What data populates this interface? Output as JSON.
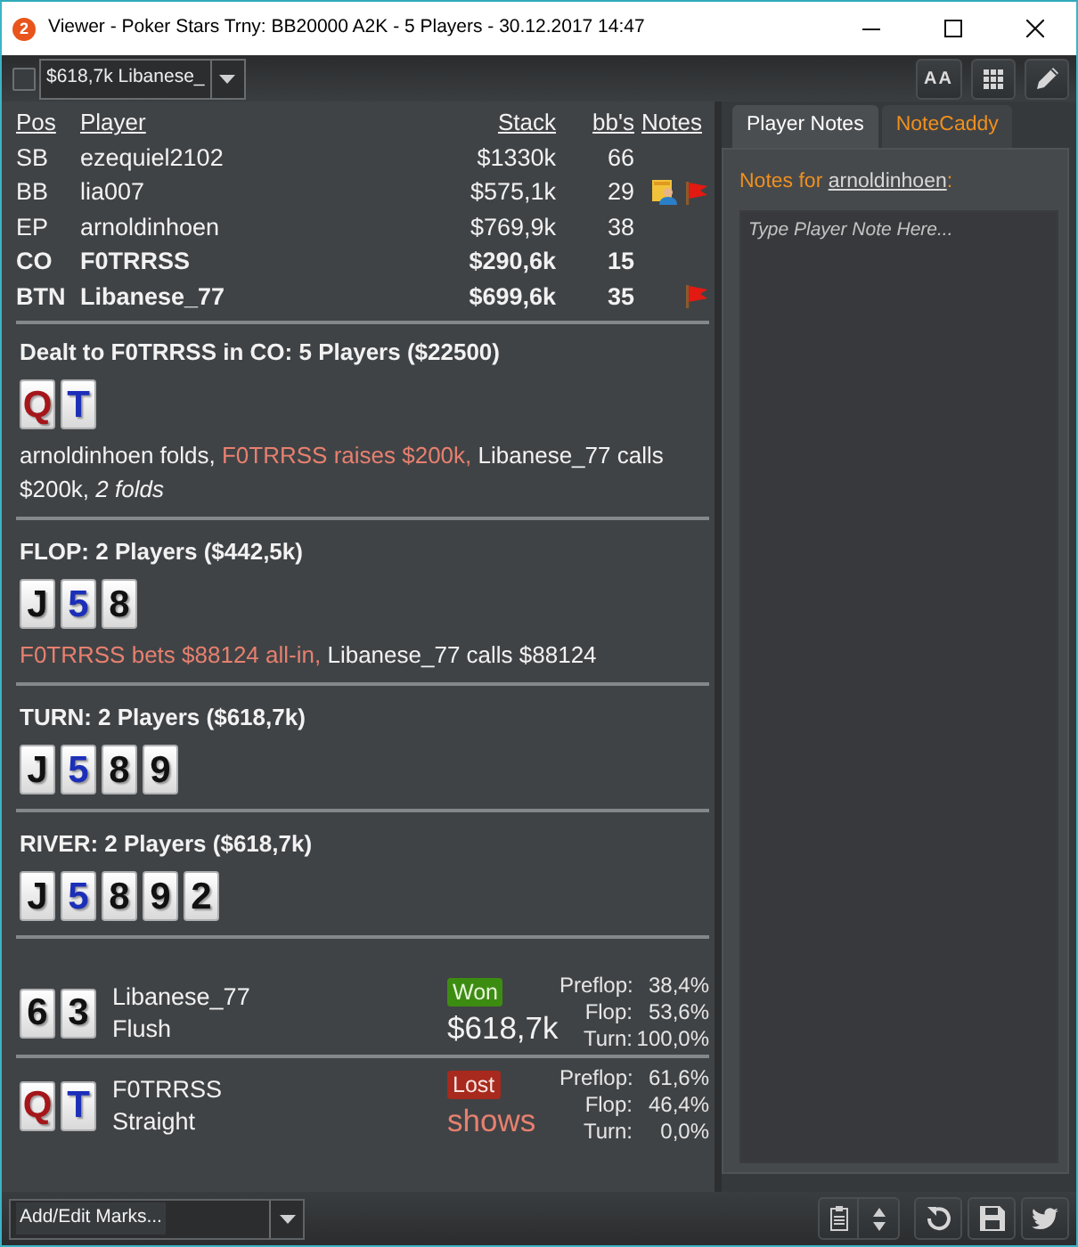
{
  "window": {
    "logo": "2",
    "title": "Viewer - Poker Stars Trny: BB20000 A2K - 5 Players - 30.12.2017 14:47"
  },
  "toolbar": {
    "select_all_checked": false,
    "hand_selector": "$618,7k Libanese_",
    "font_button": "AA"
  },
  "players_table": {
    "columns": [
      "Pos",
      "Player",
      "Stack",
      "bb's",
      "Notes"
    ],
    "rows": [
      {
        "pos": "SB",
        "player": "ezequiel2102",
        "stack": "$1330k",
        "bbs": "66",
        "bold": false,
        "note": false,
        "flag": false
      },
      {
        "pos": "BB",
        "player": "lia007",
        "stack": "$575,1k",
        "bbs": "29",
        "bold": false,
        "note": true,
        "flag": true
      },
      {
        "pos": "EP",
        "player": "arnoldinhoen",
        "stack": "$769,9k",
        "bbs": "38",
        "bold": false,
        "note": false,
        "flag": false
      },
      {
        "pos": "CO",
        "player": "F0TRRSS",
        "stack": "$290,6k",
        "bbs": "15",
        "bold": true,
        "note": false,
        "flag": false
      },
      {
        "pos": "BTN",
        "player": "Libanese_77",
        "stack": "$699,6k",
        "bbs": "35",
        "bold": true,
        "note": false,
        "flag": true
      }
    ]
  },
  "streets": [
    {
      "title": "Dealt to F0TRRSS in CO: 5 Players ($22500)",
      "cards": [
        {
          "rank": "Q",
          "color": "#a4161a"
        },
        {
          "rank": "T",
          "color": "#1c2fb8"
        }
      ],
      "actions": [
        {
          "text": "arnoldinhoen folds,",
          "highlight": false
        },
        {
          "text": "F0TRRSS raises $200k,",
          "highlight": true
        },
        {
          "text": "Libanese_77 calls $200k, *2 folds*",
          "highlight": false
        }
      ]
    },
    {
      "title": "FLOP: 2 Players ($442,5k)",
      "cards": [
        {
          "rank": "J",
          "color": "#111111"
        },
        {
          "rank": "5",
          "color": "#1c2fb8"
        },
        {
          "rank": "8",
          "color": "#111111"
        }
      ],
      "actions": [
        {
          "text": "F0TRRSS bets $88124 all-in,",
          "highlight": true
        },
        {
          "text": "Libanese_77 calls $88124",
          "highlight": false
        }
      ]
    },
    {
      "title": "TURN: 2 Players ($618,7k)",
      "cards": [
        {
          "rank": "J",
          "color": "#111111"
        },
        {
          "rank": "5",
          "color": "#1c2fb8"
        },
        {
          "rank": "8",
          "color": "#111111"
        },
        {
          "rank": "9",
          "color": "#111111"
        }
      ]
    },
    {
      "title": "RIVER: 2 Players ($618,7k)",
      "cards": [
        {
          "rank": "J",
          "color": "#111111"
        },
        {
          "rank": "5",
          "color": "#1c2fb8"
        },
        {
          "rank": "8",
          "color": "#111111"
        },
        {
          "rank": "9",
          "color": "#111111"
        },
        {
          "rank": "2",
          "color": "#111111"
        }
      ]
    }
  ],
  "showdown": [
    {
      "cards": [
        {
          "rank": "6",
          "color": "#111111"
        },
        {
          "rank": "3",
          "color": "#111111"
        }
      ],
      "player": "Libanese_77",
      "hand": "Flush",
      "result": {
        "label": "Won",
        "kind": "won"
      },
      "amount": "$618,7k",
      "equity": [
        {
          "street": "Preflop:",
          "value": "38,4%"
        },
        {
          "street": "Flop:",
          "value": "53,6%"
        },
        {
          "street": "Turn:",
          "value": "100,0%"
        }
      ]
    },
    {
      "cards": [
        {
          "rank": "Q",
          "color": "#a4161a"
        },
        {
          "rank": "T",
          "color": "#1c2fb8"
        }
      ],
      "player": "F0TRRSS",
      "hand": "Straight",
      "result": {
        "label": "Lost",
        "kind": "lost"
      },
      "amount": "shows",
      "equity": [
        {
          "street": "Preflop:",
          "value": "61,6%"
        },
        {
          "street": "Flop:",
          "value": "46,4%"
        },
        {
          "street": "Turn:",
          "value": "0,0%"
        }
      ]
    }
  ],
  "notes_panel": {
    "tabs": [
      {
        "label": "Player Notes",
        "selected": true
      },
      {
        "label": "NoteCaddy",
        "selected": false
      }
    ],
    "heading": {
      "prefix": "Notes for",
      "player": "arnoldinhoen",
      "suffix": ":"
    },
    "note_field": {
      "placeholder": "Type Player Note Here..."
    }
  },
  "bottom_bar": {
    "marks_selector": "Add/Edit Marks..."
  }
}
